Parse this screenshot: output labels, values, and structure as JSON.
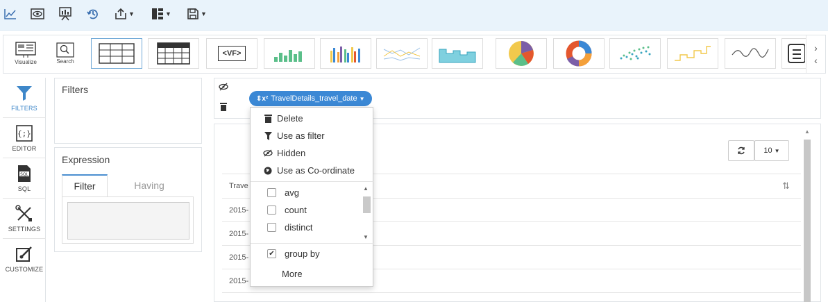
{
  "toolbar": {
    "icons": [
      "line-chart-icon",
      "preview-icon",
      "presentation-icon",
      "history-icon",
      "share-icon",
      "layout-icon",
      "save-icon"
    ]
  },
  "gallery": {
    "visualize_label": "Visualize",
    "search_label": "Search",
    "vf_label": "<VF>",
    "colors": {
      "green": "#5bbf8a",
      "blue": "#3b88d5",
      "orange": "#f4a03a",
      "yellow": "#f2c94c",
      "purple": "#7b5ea7",
      "red": "#e4572e"
    }
  },
  "sidenav": {
    "items": [
      {
        "label": "FILTERS",
        "icon": "funnel-icon"
      },
      {
        "label": "EDITOR",
        "icon": "code-braces-icon"
      },
      {
        "label": "SQL",
        "icon": "sql-file-icon"
      },
      {
        "label": "SETTINGS",
        "icon": "tools-icon"
      },
      {
        "label": "CUSTOMIZE",
        "icon": "customize-icon"
      }
    ]
  },
  "filters": {
    "title": "Filters"
  },
  "expression": {
    "title": "Expression",
    "tabs": [
      {
        "label": "Filter"
      },
      {
        "label": "Having"
      }
    ]
  },
  "axis": {
    "field_label": "TravelDetails_travel_date"
  },
  "menu": {
    "items": [
      {
        "label": "Delete",
        "icon": "trash-icon"
      },
      {
        "label": "Use as filter",
        "icon": "filter-icon"
      },
      {
        "label": "Hidden",
        "icon": "eye-slash-icon"
      },
      {
        "label": "Use as Co-ordinate",
        "icon": "globe-icon"
      }
    ],
    "aggregates": [
      {
        "label": "avg",
        "checked": false
      },
      {
        "label": "count",
        "checked": false
      },
      {
        "label": "distinct",
        "checked": false
      }
    ],
    "group_by": {
      "label": "group by",
      "checked": true
    },
    "more_label": "More"
  },
  "table": {
    "header": "Trave",
    "rows": [
      "2015-",
      "2015-",
      "2015-",
      "2015-"
    ],
    "page_size": "10"
  }
}
